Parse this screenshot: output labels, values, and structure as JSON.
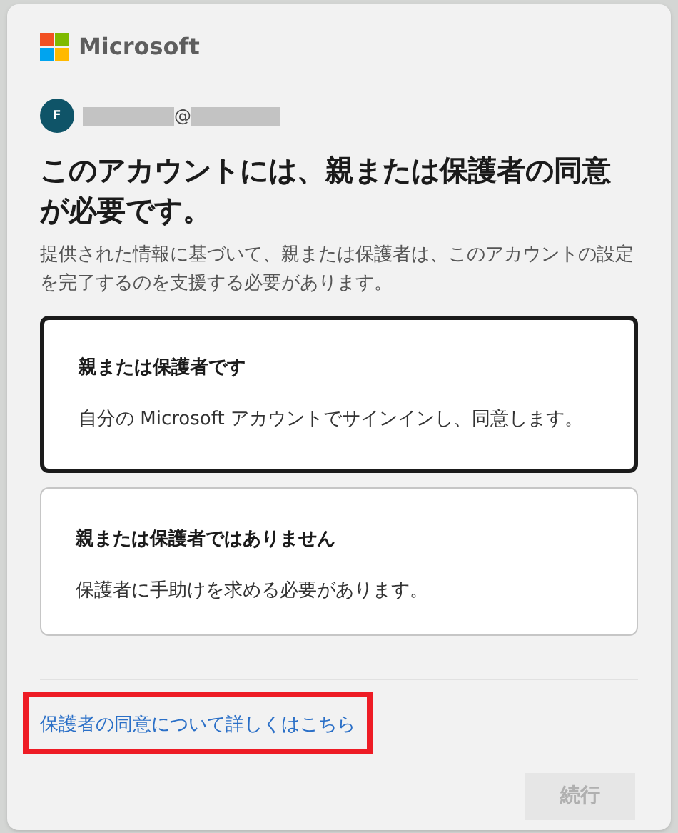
{
  "brand": {
    "name": "Microsoft"
  },
  "account": {
    "initial": "F",
    "separator": "@"
  },
  "title": "このアカウントには、親または保護者の同意が必要です。",
  "description": "提供された情報に基づいて、親または保護者は、このアカウントの設定を完了するのを支援する必要があります。",
  "options": [
    {
      "title": "親または保護者です",
      "detail": "自分の Microsoft アカウントでサインインし、同意します。",
      "selected": true
    },
    {
      "title": "親または保護者ではありません",
      "detail": "保護者に手助けを求める必要があります。",
      "selected": false
    }
  ],
  "link": {
    "label": "保護者の同意について詳しくはこちら",
    "highlighted": true
  },
  "continue_button": {
    "label": "続行",
    "disabled": true
  }
}
